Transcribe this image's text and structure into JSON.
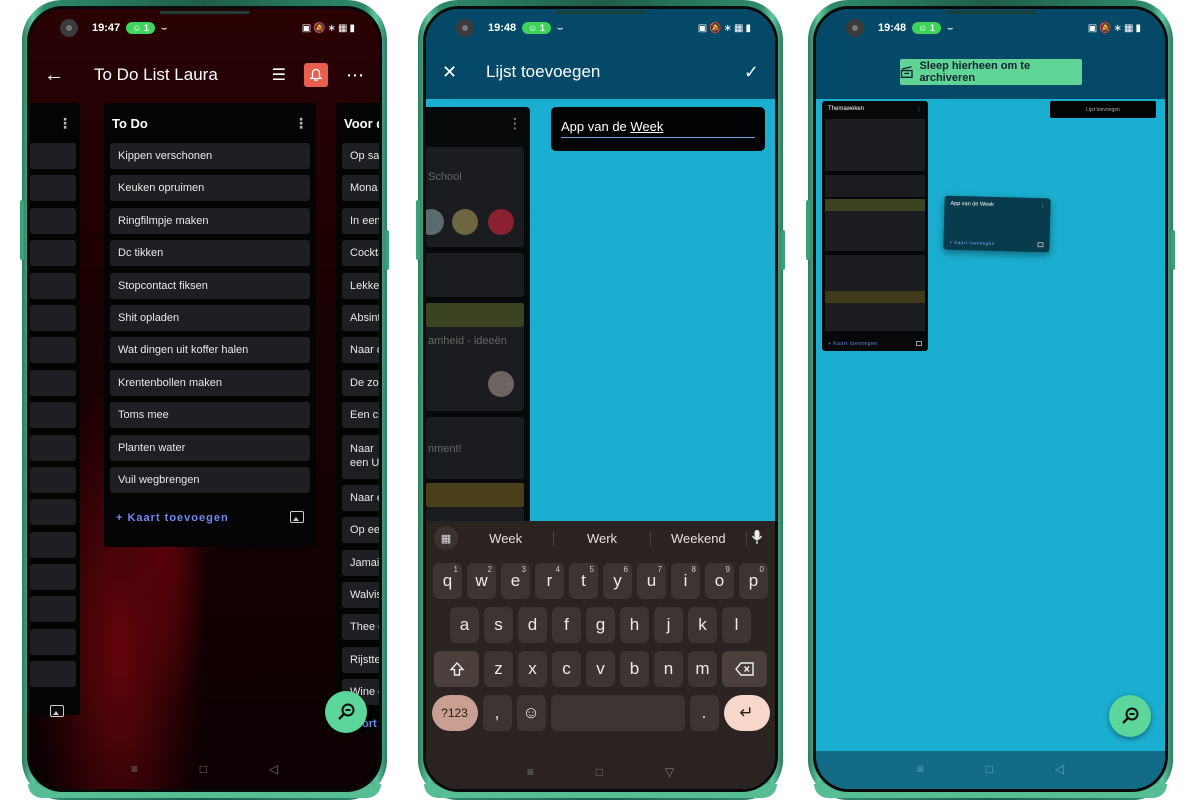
{
  "phones": [
    {
      "status": {
        "time": "19:47",
        "notif_badge": "1"
      },
      "appbar": {
        "title": "To Do List Laura"
      },
      "lists": {
        "main": {
          "title": "To Do",
          "cards": [
            "Kippen verschonen",
            "Keuken opruimen",
            "Ringfilmpje maken",
            "Dc tikken",
            "Stopcontact fiksen",
            "Shit opladen",
            "Wat dingen uit koffer halen",
            "Krentenbollen maken",
            "Toms mee",
            "Planten water",
            "Vuil wegbrengen"
          ],
          "add_card_label": "+ Kaart toevoegen"
        },
        "right": {
          "title": "Voor de",
          "cards": [
            "Op safari",
            "Mona Li",
            "In een lu",
            "Cocktail",
            "Lekker fe",
            "Absinth",
            "Naar de",
            "De zonso",
            "Een cruis",
            "Naar een UK",
            "Naar een",
            "Op een f",
            "Jamaiic",
            "Walvis w",
            "Thee dri",
            "Rijstterra",
            "Wine en"
          ],
          "add_card_label": "ort"
        }
      }
    },
    {
      "status": {
        "time": "19:48",
        "notif_badge": "1"
      },
      "appbar": {
        "title": "Lijst toevoegen"
      },
      "input": {
        "value_prefix": "App van de ",
        "value_underlined": "Week"
      },
      "background_list": {
        "texts": [
          "School",
          "amheid - ideeën",
          "nment!"
        ]
      },
      "keyboard": {
        "suggestions": [
          "Week",
          "Werk",
          "Weekend"
        ],
        "row1": [
          {
            "key": "q",
            "hint": "1"
          },
          {
            "key": "w",
            "hint": "2"
          },
          {
            "key": "e",
            "hint": "3"
          },
          {
            "key": "r",
            "hint": "4"
          },
          {
            "key": "t",
            "hint": "5"
          },
          {
            "key": "y",
            "hint": "6"
          },
          {
            "key": "u",
            "hint": "7"
          },
          {
            "key": "i",
            "hint": "8"
          },
          {
            "key": "o",
            "hint": "9"
          },
          {
            "key": "p",
            "hint": "0"
          }
        ],
        "row2": [
          "a",
          "s",
          "d",
          "f",
          "g",
          "h",
          "j",
          "k",
          "l"
        ],
        "row3": [
          "z",
          "x",
          "c",
          "v",
          "b",
          "n",
          "m"
        ],
        "symbols_label": "?123",
        "comma": ",",
        "period": "."
      }
    },
    {
      "status": {
        "time": "19:48",
        "notif_badge": "1"
      },
      "archive_banner": "Sleep hierheen om te archiveren",
      "list_title": "Themaweken",
      "add_card_label": "+ Kaart toevoegen",
      "add_list_label": "Lijst toevoegen",
      "dragged_list": {
        "title": "App van de Week",
        "add_card_label": "+ Kaart toevoegen"
      }
    }
  ],
  "colors": {
    "fab": "#5dd69b",
    "bell": "#e95f4e",
    "board_bg": "#1aaed0",
    "appbar_blue": "#044a68",
    "link_blue": "#6c8bf0",
    "archive_green": "#5fd494"
  }
}
